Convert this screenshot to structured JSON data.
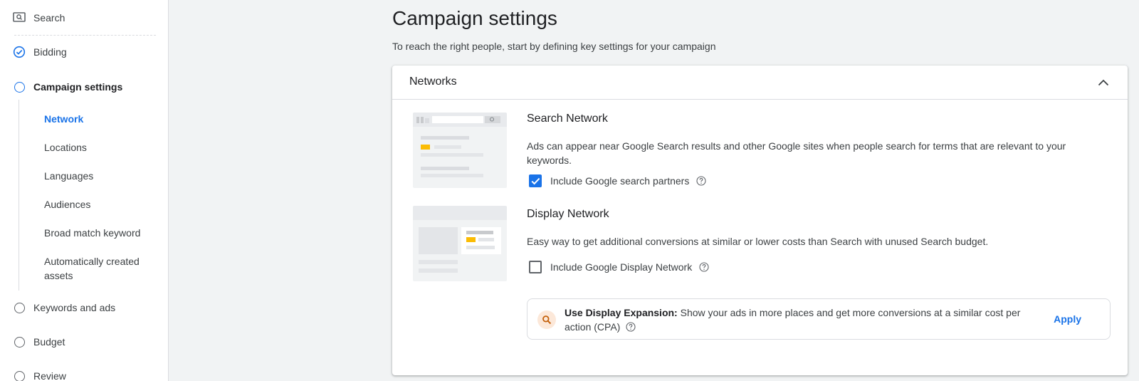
{
  "sidebar": {
    "steps": [
      {
        "label": "Search",
        "icon": "search-campaign-icon"
      },
      {
        "label": "Bidding",
        "icon": "check-circle-icon"
      },
      {
        "label": "Campaign settings",
        "icon": "circle-outline-icon"
      },
      {
        "label": "Keywords and ads",
        "icon": "circle-outline-icon"
      },
      {
        "label": "Budget",
        "icon": "circle-outline-icon"
      },
      {
        "label": "Review",
        "icon": "circle-outline-icon"
      }
    ],
    "sub_items": [
      "Network",
      "Locations",
      "Languages",
      "Audiences",
      "Broad match keyword",
      "Automatically created assets"
    ],
    "active_sub": "Network"
  },
  "header": {
    "title": "Campaign settings",
    "subtitle": "To reach the right people, start by defining key settings for your campaign"
  },
  "networks": {
    "title": "Networks",
    "search": {
      "title": "Search Network",
      "description": "Ads can appear near Google Search results and other Google sites when people search for terms that are relevant to your keywords.",
      "checkbox_label": "Include Google search partners",
      "checked": true
    },
    "display": {
      "title": "Display Network",
      "description": "Easy way to get additional conversions at similar or lower costs than Search with unused Search budget.",
      "checkbox_label": "Include Google Display Network",
      "checked": false
    },
    "promo": {
      "bold": "Use Display Expansion:",
      "text": " Show your ads in more places and get more conversions at a similar cost per action (CPA)",
      "action": "Apply"
    }
  },
  "colors": {
    "accent": "#1a73e8",
    "highlight": "#fbbc04",
    "promo_icon_bg": "#fce8d9"
  }
}
